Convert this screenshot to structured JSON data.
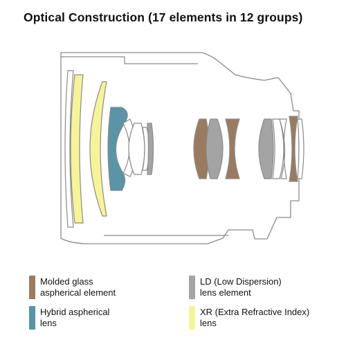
{
  "title": "Optical Construction (17 elements in 12 groups)",
  "colors": {
    "molded_glass_aspherical": "#9b7b60",
    "hybrid_aspherical": "#5b94a6",
    "ld": "#a4a4a4",
    "xr": "#f6f39a",
    "standard_element_fill": "#ffffff",
    "outline": "#8a8a8a"
  },
  "legend": [
    {
      "key": "molded_glass_aspherical",
      "line1": "Molded glass",
      "line2": "aspherical element"
    },
    {
      "key": "ld",
      "line1": "LD (Low Dispersion)",
      "line2": "lens element"
    },
    {
      "key": "hybrid_aspherical",
      "line1": "Hybrid aspherical",
      "line2": "lens"
    },
    {
      "key": "xr",
      "line1": "XR (Extra Refractive Index)",
      "line2": "lens"
    }
  ]
}
